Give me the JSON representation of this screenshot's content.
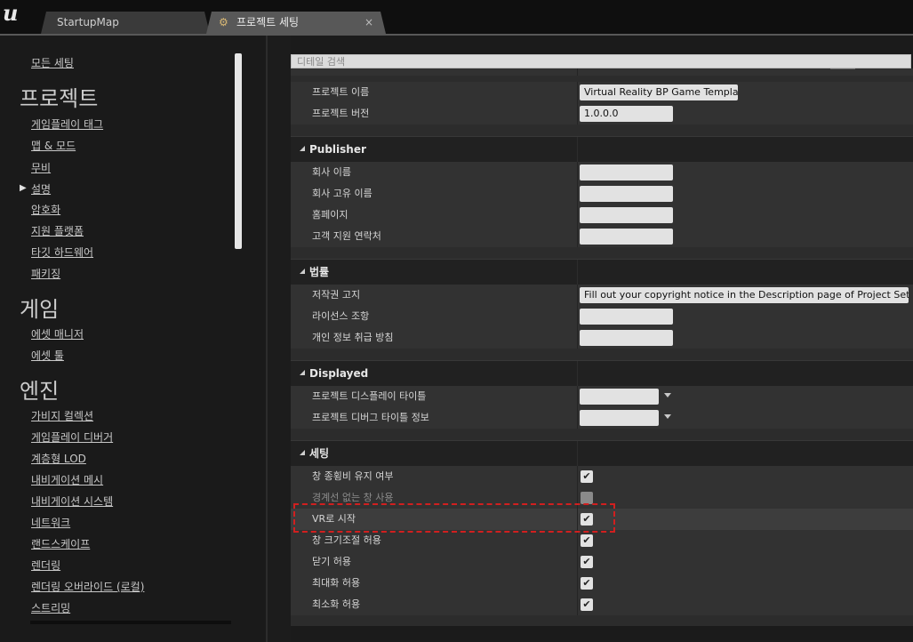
{
  "titlebar": {
    "logo": "u",
    "tabs": [
      {
        "label": "StartupMap"
      },
      {
        "label": "프로젝트 세팅",
        "close": "×"
      }
    ]
  },
  "left": {
    "all_settings": "모든 세팅",
    "project_header": "프로젝트",
    "project_items": [
      "게임플레이 태그",
      "맵 & 모드",
      "무비",
      "설명",
      "암호화",
      "지원 플랫폼",
      "타깃 하드웨어",
      "패키징"
    ],
    "selected_item": "설명",
    "game_header": "게임",
    "game_items": [
      "에셋 매니저",
      "에셋 툴"
    ],
    "engine_header": "엔진",
    "engine_items": [
      "가비지 컬렉션",
      "게임플레이 디버거",
      "계층형 LOD",
      "내비게이션 메시",
      "내비게이션 시스템",
      "네트워크",
      "랜드스케이프",
      "렌더링",
      "렌더링 오버라이드 (로컬)",
      "스트리밍"
    ]
  },
  "search": {
    "placeholder": "디테일 검색"
  },
  "details": {
    "project_rows": [
      {
        "label": "프로젝트 이름",
        "value": "Virtual Reality BP Game Template"
      },
      {
        "label": "프로젝트 버전",
        "value": "1.0.0.0"
      }
    ],
    "publisher": {
      "title": "Publisher",
      "rows": [
        {
          "label": "회사 이름",
          "value": ""
        },
        {
          "label": "회사 고유 이름",
          "value": ""
        },
        {
          "label": "홈페이지",
          "value": ""
        },
        {
          "label": "고객 지원 연락처",
          "value": ""
        }
      ]
    },
    "legal": {
      "title": "법률",
      "rows": [
        {
          "label": "저작권 고지",
          "value": "Fill out your copyright notice in the Description page of Project Settings."
        },
        {
          "label": "라이선스 조항",
          "value": ""
        },
        {
          "label": "개인 정보 취급 방침",
          "value": ""
        }
      ]
    },
    "displayed": {
      "title": "Displayed",
      "rows": [
        {
          "label": "프로젝트 디스플레이 타이틀",
          "value": ""
        },
        {
          "label": "프로젝트 디버그 타이틀 정보",
          "value": ""
        }
      ]
    },
    "settings": {
      "title": "세팅",
      "rows": [
        {
          "label": "창 종횡비 유지 여부",
          "checked": true,
          "enabled": true
        },
        {
          "label": "경계선 없는 창 사용",
          "checked": false,
          "enabled": false
        },
        {
          "label": "VR로 시작",
          "checked": true,
          "enabled": true
        },
        {
          "label": "창 크기조절 허용",
          "checked": true,
          "enabled": true
        },
        {
          "label": "닫기 허용",
          "checked": true,
          "enabled": true
        },
        {
          "label": "최대화 허용",
          "checked": true,
          "enabled": true
        },
        {
          "label": "최소화 허용",
          "checked": true,
          "enabled": true
        }
      ]
    },
    "check_glyph": "✔"
  },
  "colors": {
    "highlight_border": "#d11f1f",
    "field_bg": "#e2e2e2",
    "section_bg": "#212121"
  }
}
